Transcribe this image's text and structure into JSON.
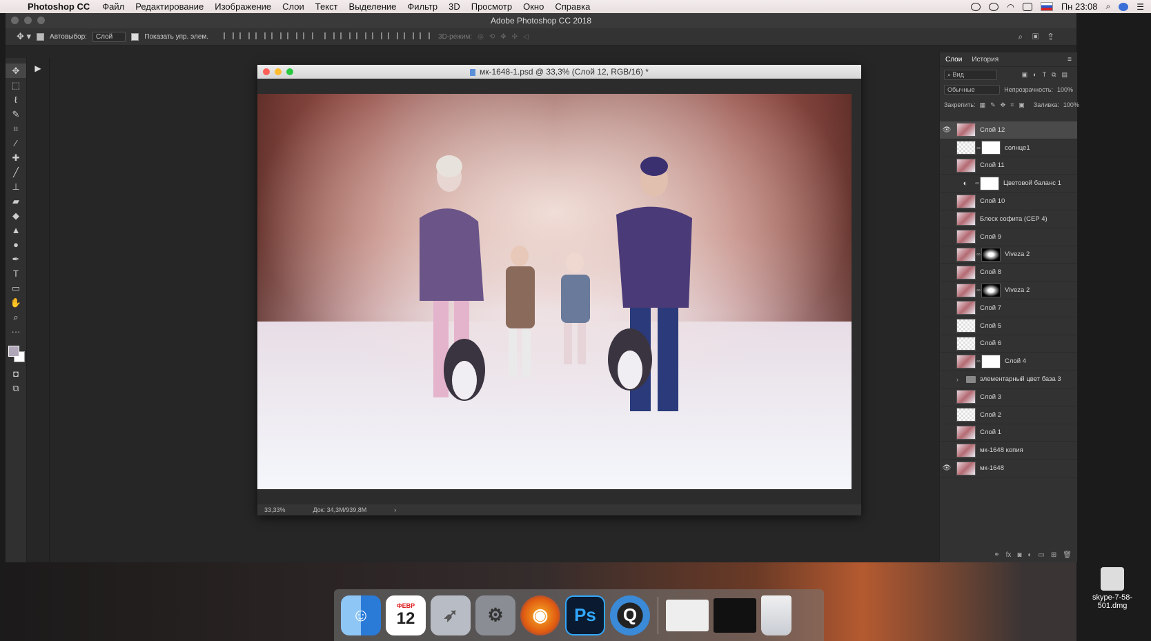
{
  "menubar": {
    "app": "Photoshop CC",
    "items": [
      "Файл",
      "Редактирование",
      "Изображение",
      "Слои",
      "Текст",
      "Выделение",
      "Фильтр",
      "3D",
      "Просмотр",
      "Окно",
      "Справка"
    ],
    "clock": "Пн 23:08"
  },
  "window": {
    "title": "Adobe Photoshop CC 2018"
  },
  "options": {
    "autoselect_label": "Автовыбор:",
    "autoselect_value": "Слой",
    "show_controls_label": "Показать упр. элем.",
    "mode3d_label": "3D-режим:"
  },
  "document": {
    "title": "мк-1648-1.psd @ 33,3% (Слой 12, RGB/16) *",
    "zoom": "33,33%",
    "doc_size": "Док: 34,3M/939,8M"
  },
  "panel": {
    "tabs": [
      "Слои",
      "История"
    ],
    "filter": "Вид",
    "blend_mode": "Обычные",
    "opacity_label": "Непрозрачность:",
    "opacity": "100%",
    "lock_label": "Закрепить:",
    "fill_label": "Заливка:",
    "fill": "100%"
  },
  "layers": [
    {
      "name": "Слой 12",
      "visible": true,
      "selected": true,
      "thumb": "photo",
      "mask": null
    },
    {
      "name": "солнце1",
      "visible": false,
      "selected": false,
      "thumb": "trans",
      "mask": "white"
    },
    {
      "name": "Слой 11",
      "visible": false,
      "selected": false,
      "thumb": "photo",
      "mask": null
    },
    {
      "name": "Цветовой баланс 1",
      "visible": false,
      "selected": false,
      "thumb": "adjust",
      "mask": "white"
    },
    {
      "name": "Слой 10",
      "visible": false,
      "selected": false,
      "thumb": "photo",
      "mask": null
    },
    {
      "name": "Блеск софита (СЕР 4)",
      "visible": false,
      "selected": false,
      "thumb": "photo",
      "mask": null
    },
    {
      "name": "Слой 9",
      "visible": false,
      "selected": false,
      "thumb": "photo",
      "mask": null
    },
    {
      "name": "Viveza 2",
      "visible": false,
      "selected": false,
      "thumb": "photo",
      "mask": "dark"
    },
    {
      "name": "Слой 8",
      "visible": false,
      "selected": false,
      "thumb": "photo",
      "mask": null
    },
    {
      "name": "Viveza 2",
      "visible": false,
      "selected": false,
      "thumb": "photo",
      "mask": "dark"
    },
    {
      "name": "Слой 7",
      "visible": false,
      "selected": false,
      "thumb": "photo",
      "mask": null
    },
    {
      "name": "Слой 5",
      "visible": false,
      "selected": false,
      "thumb": "trans",
      "mask": null
    },
    {
      "name": "Слой 6",
      "visible": false,
      "selected": false,
      "thumb": "trans",
      "mask": null
    },
    {
      "name": "Слой 4",
      "visible": false,
      "selected": false,
      "thumb": "photo",
      "mask": "white"
    },
    {
      "name": "элементарный цвет база 3",
      "visible": false,
      "selected": false,
      "thumb": "folder",
      "mask": null
    },
    {
      "name": "Слой 3",
      "visible": false,
      "selected": false,
      "thumb": "photo",
      "mask": null
    },
    {
      "name": "Слой 2",
      "visible": false,
      "selected": false,
      "thumb": "trans",
      "mask": null
    },
    {
      "name": "Слой 1",
      "visible": false,
      "selected": false,
      "thumb": "photo",
      "mask": null
    },
    {
      "name": "мк-1648 копия",
      "visible": false,
      "selected": false,
      "thumb": "photo",
      "mask": null
    },
    {
      "name": "мк-1648",
      "visible": true,
      "selected": false,
      "thumb": "photo",
      "mask": null
    }
  ],
  "dock": {
    "calendar_month": "ФЕВР",
    "calendar_day": "12",
    "ps_label": "Ps"
  },
  "desktop_file": {
    "name": "skype-7-58-501.dmg"
  }
}
